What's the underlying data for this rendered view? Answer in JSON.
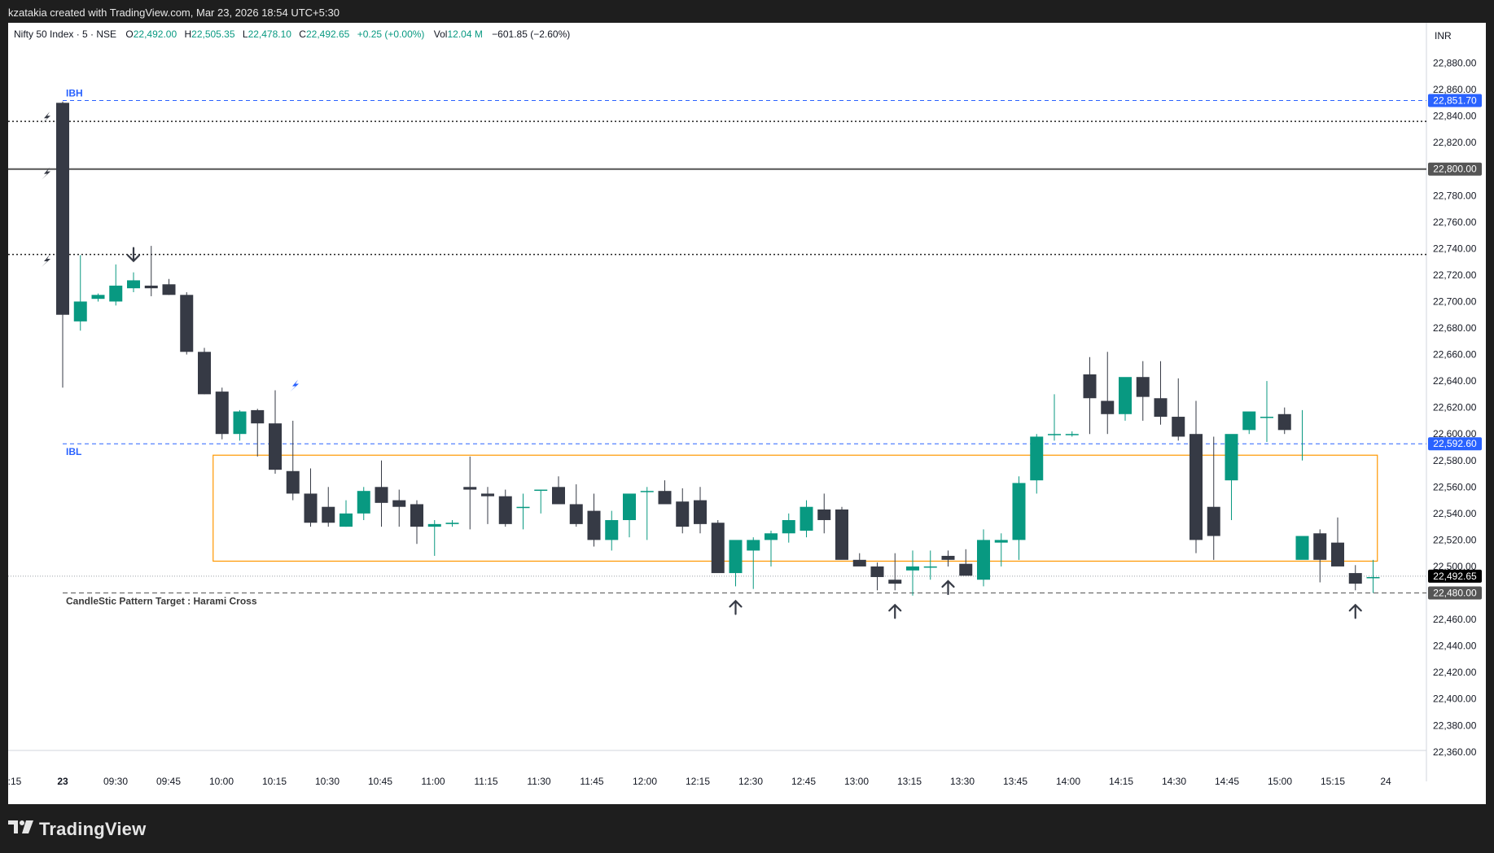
{
  "attribution": "kzatakia created with TradingView.com, Mar 23, 2026 18:54 UTC+5:30",
  "brand": "TradingView",
  "currency": "INR",
  "legend": {
    "symbol": "Nifty 50 Index · 5 · NSE",
    "o_label": "O",
    "o_value": "22,492.00",
    "h_label": "H",
    "h_value": "22,505.35",
    "l_label": "L",
    "l_value": "22,478.10",
    "c_label": "C",
    "c_value": "22,492.65",
    "change": "+0.25 (+0.00%)",
    "vol_label": "Vol",
    "vol_value": "12.04 M",
    "vol_change": "−601.85 (−2.60%)"
  },
  "colors": {
    "up": "#089981",
    "down": "#363a45",
    "level_line": "#2962ff",
    "zone": "#ff9800",
    "axis_text": "#131722"
  },
  "chart_data": {
    "type": "candlestick",
    "ylim": [
      22340,
      22905
    ],
    "y_ticks": [
      "22,360.00",
      "22,380.00",
      "22,400.00",
      "22,420.00",
      "22,440.00",
      "22,460.00",
      "22,480.00",
      "22,500.00",
      "22,520.00",
      "22,540.00",
      "22,560.00",
      "22,580.00",
      "22,600.00",
      "22,620.00",
      "22,640.00",
      "22,660.00",
      "22,680.00",
      "22,700.00",
      "22,720.00",
      "22,740.00",
      "22,760.00",
      "22,780.00",
      "22,800.00",
      "22,820.00",
      "22,840.00",
      "22,860.00",
      "22,880.00"
    ],
    "x_ticks": [
      ":15",
      "23",
      "09:30",
      "09:45",
      "10:00",
      "10:15",
      "10:30",
      "10:45",
      "11:00",
      "11:15",
      "11:30",
      "11:45",
      "12:00",
      "12:15",
      "12:30",
      "12:45",
      "13:00",
      "13:15",
      "13:30",
      "13:45",
      "14:00",
      "14:15",
      "14:30",
      "14:45",
      "15:00",
      "15:15",
      "24"
    ],
    "time": [
      "09:15",
      "09:20",
      "09:25",
      "09:30",
      "09:35",
      "09:40",
      "09:45",
      "09:50",
      "09:55",
      "10:00",
      "10:05",
      "10:10",
      "10:15",
      "10:20",
      "10:25",
      "10:30",
      "10:35",
      "10:40",
      "10:45",
      "10:50",
      "10:55",
      "11:00",
      "11:05",
      "11:10",
      "11:15",
      "11:20",
      "11:25",
      "11:30",
      "11:35",
      "11:40",
      "11:45",
      "11:50",
      "11:55",
      "12:00",
      "12:05",
      "12:10",
      "12:15",
      "12:20",
      "12:25",
      "12:30",
      "12:35",
      "12:40",
      "12:45",
      "12:50",
      "12:55",
      "13:00",
      "13:05",
      "13:10",
      "13:15",
      "13:20",
      "13:25",
      "13:30",
      "13:35",
      "13:40",
      "13:45",
      "13:50",
      "13:55",
      "14:00",
      "14:05",
      "14:10",
      "14:15",
      "14:20",
      "14:25",
      "14:30",
      "14:35",
      "14:40",
      "14:45",
      "14:50",
      "14:55",
      "15:00",
      "15:05",
      "15:10",
      "15:15",
      "15:20",
      "15:25"
    ],
    "open": [
      22850,
      22685,
      22702,
      22700,
      22710,
      22712,
      22713,
      22705,
      22662,
      22632,
      22600,
      22618,
      22608,
      22572,
      22555,
      22545,
      22530,
      22540,
      22560,
      22550,
      22547,
      22530,
      22532,
      22560,
      22555,
      22553,
      22545,
      22558,
      22560,
      22547,
      22542,
      22520,
      22535,
      22557,
      22557,
      22549,
      22550,
      22533,
      22495,
      22512,
      22520,
      22525,
      22527,
      22543,
      22543,
      22505,
      22500,
      22490,
      22497,
      22500,
      22508,
      22502,
      22490,
      22518,
      22520,
      22565,
      22600,
      22600,
      22645,
      22625,
      22615,
      22643,
      22627,
      22613,
      22600,
      22545,
      22565,
      22603,
      22613,
      22615,
      22505,
      22525,
      22518,
      22495,
      22492
    ],
    "close": [
      22690,
      22700,
      22705,
      22712,
      22716,
      22710,
      22705,
      22662,
      22630,
      22600,
      22617,
      22608,
      22573,
      22555,
      22533,
      22533,
      22540,
      22557,
      22548,
      22545,
      22530,
      22532,
      22533,
      22558,
      22553,
      22532,
      22545,
      22558,
      22547,
      22532,
      22520,
      22535,
      22555,
      22557,
      22547,
      22530,
      22532,
      22495,
      22520,
      22520,
      22525,
      22535,
      22545,
      22535,
      22505,
      22500,
      22492,
      22487,
      22500,
      22500,
      22505,
      22493,
      22520,
      22520,
      22563,
      22598,
      22600,
      22600,
      22627,
      22615,
      22643,
      22628,
      22613,
      22598,
      22520,
      22523,
      22600,
      22617,
      22613,
      22603,
      22523,
      22505,
      22500,
      22487,
      22492
    ],
    "high": [
      22851,
      22735,
      22706,
      22728,
      22722,
      22742,
      22717,
      22707,
      22665,
      22635,
      22618,
      22619,
      22633,
      22610,
      22574,
      22560,
      22550,
      22560,
      22580,
      22558,
      22550,
      22535,
      22535,
      22583,
      22560,
      22558,
      22555,
      22558,
      22568,
      22562,
      22555,
      22542,
      22550,
      22560,
      22565,
      22559,
      22560,
      22535,
      22500,
      22522,
      22527,
      22540,
      22550,
      22555,
      22545,
      22510,
      22503,
      22510,
      22512,
      22512,
      22512,
      22513,
      22528,
      22525,
      22568,
      22600,
      22630,
      22602,
      22658,
      22662,
      22632,
      22655,
      22655,
      22642,
      22625,
      22598,
      22588,
      22606,
      22640,
      22620,
      22618,
      22528,
      22537,
      22501,
      22505
    ],
    "low": [
      22635,
      22678,
      22700,
      22697,
      22707,
      22704,
      22705,
      22660,
      22630,
      22596,
      22595,
      22583,
      22570,
      22550,
      22530,
      22530,
      22530,
      22535,
      22530,
      22530,
      22517,
      22508,
      22530,
      22528,
      22532,
      22530,
      22528,
      22540,
      22550,
      22530,
      22515,
      22512,
      22522,
      22520,
      22555,
      22525,
      22525,
      22530,
      22485,
      22483,
      22500,
      22518,
      22522,
      22525,
      22530,
      22503,
      22482,
      22482,
      22478,
      22490,
      22500,
      22495,
      22485,
      22500,
      22505,
      22555,
      22595,
      22598,
      22600,
      22600,
      22610,
      22610,
      22607,
      22595,
      22510,
      22505,
      22535,
      22600,
      22594,
      22600,
      22580,
      22488,
      22510,
      22482,
      22480
    ],
    "levels": {
      "IBH": 22851.7,
      "IBL": 22592.6,
      "round_level": 22800.0,
      "dotted_upper": 22836.0,
      "dotted_lower": 22735.5,
      "target": 22480.0,
      "last_price": 22492.65
    },
    "level_labels": {
      "IBH": "22,851.70",
      "IBL": "22,592.60",
      "round_level": "22,800.00",
      "target": "22,480.00",
      "last_price": "22,492.65"
    },
    "zone": {
      "from_time": "10:00",
      "to_time": "15:20",
      "top": 22584,
      "bottom": 22504
    },
    "annotations": {
      "ibh_label": "IBH",
      "ibl_label": "IBL",
      "target_label": "CandleStic Pattern Target : Harami Cross",
      "down_arrows": [
        "09:35"
      ],
      "up_arrows": [
        "12:25",
        "13:10",
        "13:25",
        "15:20"
      ],
      "lightning_icons": [
        22839,
        22797,
        22731
      ],
      "blue_lightning_time": "10:15"
    }
  }
}
